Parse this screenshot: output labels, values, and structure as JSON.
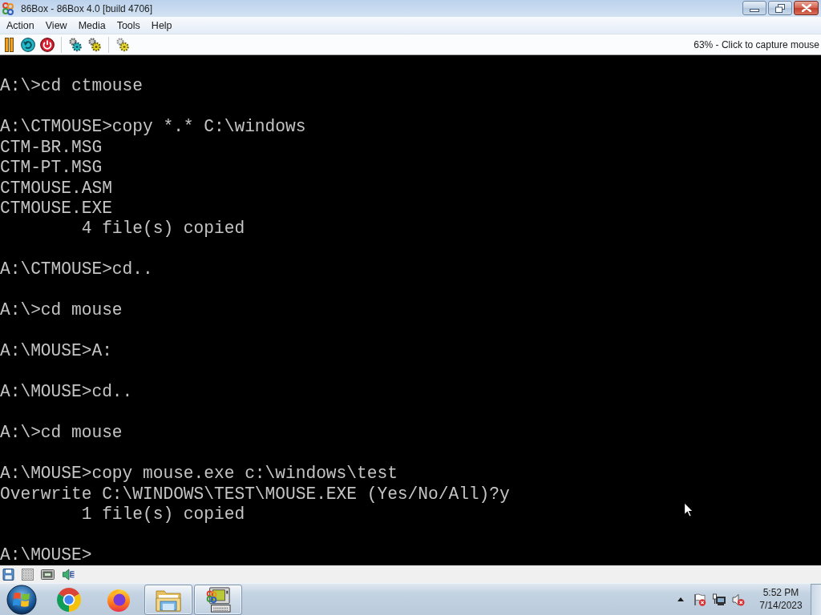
{
  "window": {
    "title": "86Box - 86Box 4.0 [build 4706]"
  },
  "menu": [
    "Action",
    "View",
    "Media",
    "Tools",
    "Help"
  ],
  "toolbar": {
    "status": "63% - Click to capture mouse"
  },
  "screen": {
    "blocks": [
      {
        "lines": [
          "A:\\>cd ctmouse"
        ]
      },
      {
        "lines": [
          "A:\\CTMOUSE>copy *.* C:\\windows",
          "CTM-BR.MSG",
          "CTM-PT.MSG",
          "CTMOUSE.ASM",
          "CTMOUSE.EXE",
          "        4 file(s) copied"
        ]
      },
      {
        "lines": [
          "A:\\CTMOUSE>cd.."
        ]
      },
      {
        "lines": [
          "A:\\>cd mouse"
        ]
      },
      {
        "lines": [
          "A:\\MOUSE>A:"
        ]
      },
      {
        "lines": [
          "A:\\MOUSE>cd.."
        ]
      },
      {
        "lines": [
          "A:\\>cd mouse"
        ]
      },
      {
        "lines": [
          "A:\\MOUSE>copy mouse.exe c:\\windows\\test",
          "Overwrite C:\\WINDOWS\\TEST\\MOUSE.EXE (Yes/No/All)?y",
          "        1 file(s) copied"
        ]
      },
      {
        "lines": [
          "A:\\MOUSE>"
        ]
      }
    ]
  },
  "taskbar": {
    "apps": [
      {
        "kind": "chrome",
        "running": false
      },
      {
        "kind": "firefox",
        "running": false
      },
      {
        "kind": "folder",
        "running": true
      },
      {
        "kind": "emulator",
        "running": true
      }
    ],
    "clock": {
      "time": "5:52 PM",
      "date": "7/14/2023"
    }
  }
}
